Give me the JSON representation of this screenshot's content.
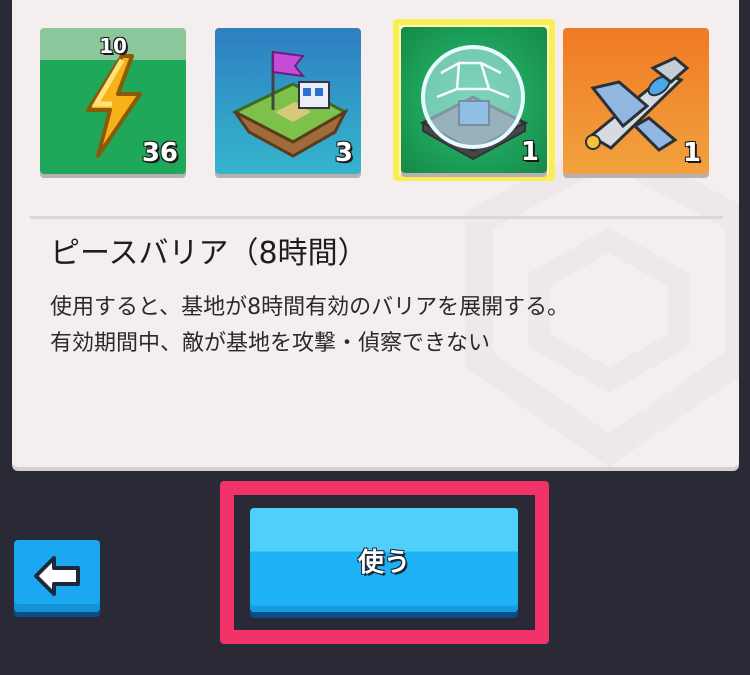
{
  "items": [
    {
      "name": "energy",
      "level": "10",
      "count": "36",
      "icon": "lightning-bolt-icon"
    },
    {
      "name": "base-island",
      "count": "3",
      "icon": "flag-island-icon"
    },
    {
      "name": "peace-barrier",
      "count": "1",
      "icon": "dome-barrier-icon",
      "selected": true
    },
    {
      "name": "fighter-jet",
      "count": "1",
      "icon": "jet-plane-icon"
    }
  ],
  "detail": {
    "title": "ピースバリア（8時間）",
    "description_line1": "使用すると、基地が8時間有効のバリアを展開する。",
    "description_line2": "有効期間中、敵が基地を攻撃・偵察できない"
  },
  "actions": {
    "use_label": "使う",
    "back_icon": "arrow-left-icon"
  },
  "colors": {
    "highlight": "#f2336a",
    "selection": "#f7ef55",
    "button": "#1eb1f3"
  }
}
